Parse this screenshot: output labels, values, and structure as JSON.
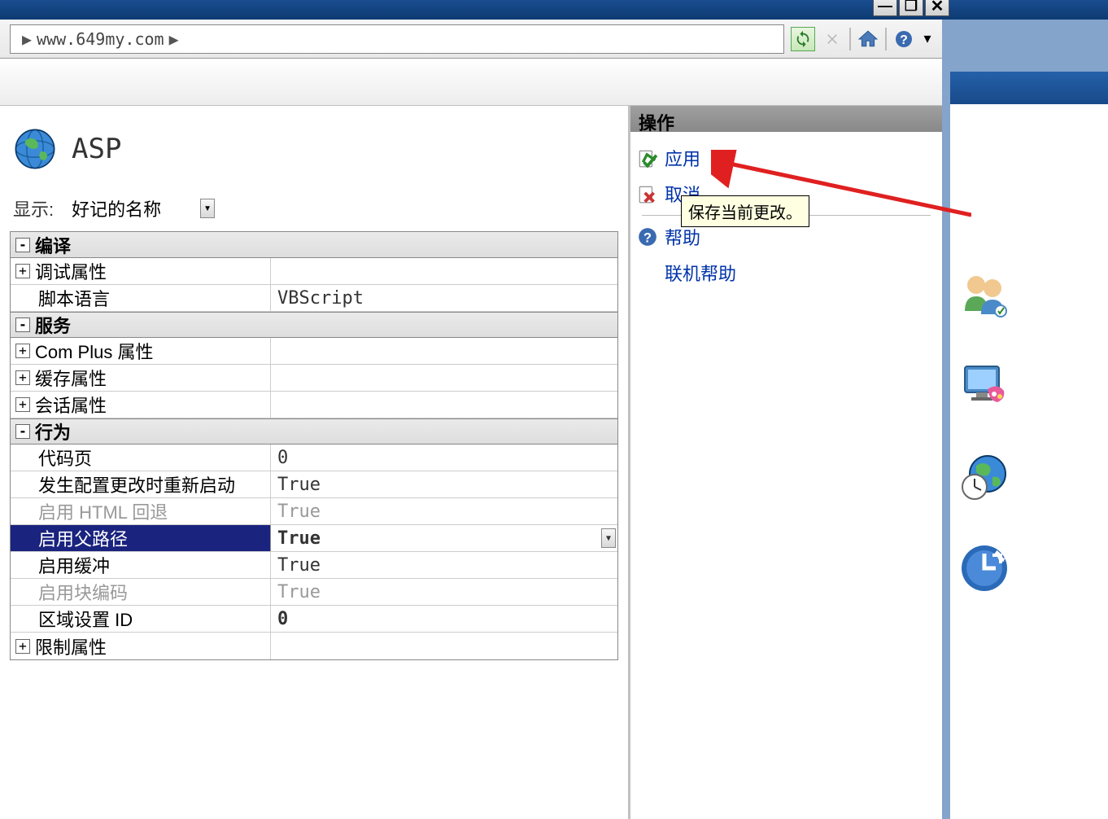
{
  "titlebar": {
    "minimize_tip": "Minimize",
    "maximize_tip": "Maximize",
    "close_tip": "Close"
  },
  "breadcrumb": {
    "url": "www.649my.com"
  },
  "page": {
    "title": "ASP",
    "display_label": "显示:",
    "display_value": "好记的名称"
  },
  "sections": {
    "compile": "编译",
    "debug_props": "调试属性",
    "script_lang_label": "脚本语言",
    "script_lang_value": "VBScript",
    "service": "服务",
    "complus_props": "Com Plus 属性",
    "cache_props": "缓存属性",
    "session_props": "会话属性",
    "behavior": "行为",
    "code_page_label": "代码页",
    "code_page_value": "0",
    "restart_on_config_label": "发生配置更改时重新启动",
    "restart_on_config_value": "True",
    "enable_html_fallback_label": "启用 HTML 回退",
    "enable_html_fallback_value": "True",
    "enable_parent_paths_label": "启用父路径",
    "enable_parent_paths_value": "True",
    "enable_buffering_label": "启用缓冲",
    "enable_buffering_value": "True",
    "enable_chunked_label": "启用块编码",
    "enable_chunked_value": "True",
    "locale_id_label": "区域设置 ID",
    "locale_id_value": "0",
    "limit_props": "限制属性"
  },
  "actions": {
    "header": "操作",
    "apply": "应用",
    "cancel": "取消",
    "help": "帮助",
    "online_help": "联机帮助",
    "tooltip_apply": "保存当前更改。"
  }
}
